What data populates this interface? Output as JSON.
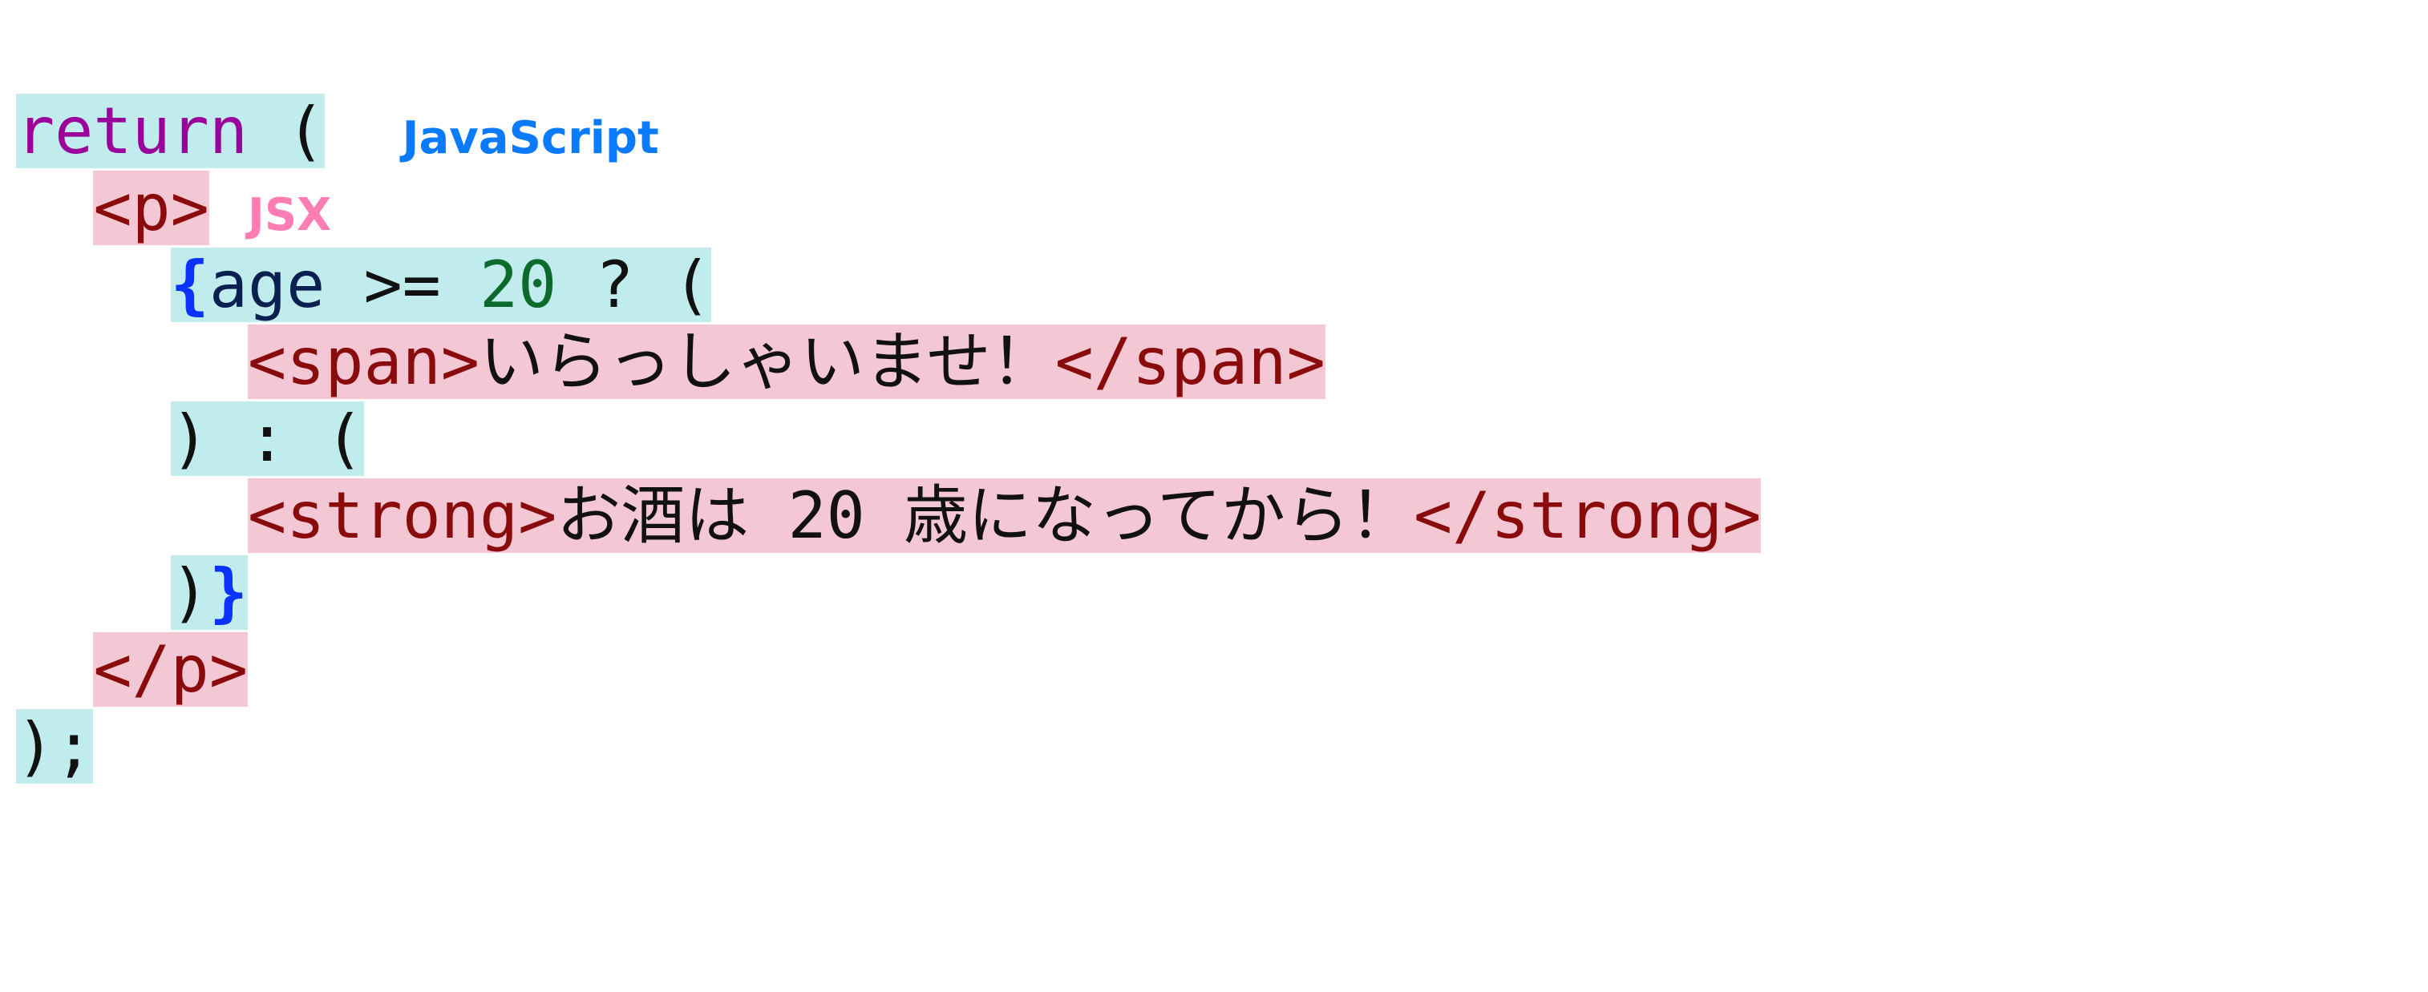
{
  "labels": {
    "javascript": "JavaScript",
    "jsx": "JSX"
  },
  "code": {
    "return": "return",
    "open_paren": "(",
    "p_open": "<p>",
    "brace_open": "{",
    "ident_age": "age",
    "op_gte": ">=",
    "num_20": "20",
    "op_qmark": "?",
    "open_paren2": "(",
    "span_open": "<span>",
    "text_welcome": "いらっしゃいませ！",
    "span_close": "</span>",
    "close_paren1": ")",
    "op_colon": ":",
    "open_paren3": "(",
    "strong_open": "<strong>",
    "text_underage": "お酒は 20 歳になってから！",
    "strong_close": "</strong>",
    "close_paren2": ")",
    "brace_close": "}",
    "p_close": "</p>",
    "final_paren": ")",
    "final_semi": ";"
  }
}
